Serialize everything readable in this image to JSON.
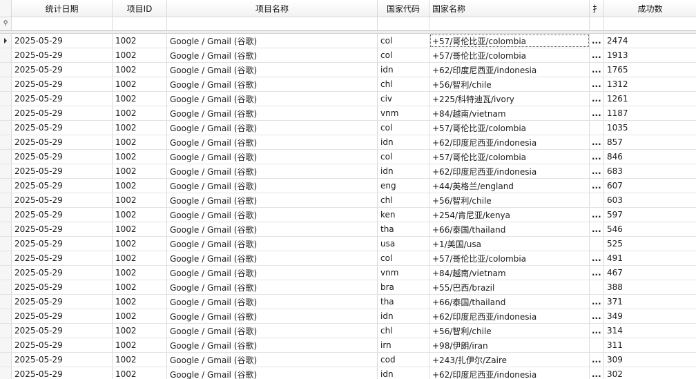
{
  "columns": {
    "date": "统计日期",
    "project_id": "项目ID",
    "project_name": "项目名称",
    "country_code": "国家代码",
    "country_name": "国家名称",
    "truncated": "扌",
    "success_count": "成功数"
  },
  "filter_icon": "filter-icon",
  "ellipsis": "...",
  "rows": [
    {
      "date": "2025-05-29",
      "pid": "1002",
      "name": "Google / Gmail (谷歌)",
      "code": "col",
      "country": "+57/哥伦比亚/colombia",
      "trunc": true,
      "count": "2474"
    },
    {
      "date": "2025-05-29",
      "pid": "1002",
      "name": "Google / Gmail (谷歌)",
      "code": "col",
      "country": "+57/哥伦比亚/colombia",
      "trunc": true,
      "count": "1913"
    },
    {
      "date": "2025-05-29",
      "pid": "1002",
      "name": "Google / Gmail (谷歌)",
      "code": "idn",
      "country": "+62/印度尼西亚/indonesia",
      "trunc": true,
      "count": "1765"
    },
    {
      "date": "2025-05-29",
      "pid": "1002",
      "name": "Google / Gmail (谷歌)",
      "code": "chl",
      "country": "+56/智利/chile",
      "trunc": true,
      "count": "1312"
    },
    {
      "date": "2025-05-29",
      "pid": "1002",
      "name": "Google / Gmail (谷歌)",
      "code": "civ",
      "country": "+225/科特迪瓦/ivory",
      "trunc": true,
      "count": "1261"
    },
    {
      "date": "2025-05-29",
      "pid": "1002",
      "name": "Google / Gmail (谷歌)",
      "code": "vnm",
      "country": "+84/越南/vietnam",
      "trunc": true,
      "count": "1187"
    },
    {
      "date": "2025-05-29",
      "pid": "1002",
      "name": "Google / Gmail (谷歌)",
      "code": "col",
      "country": "+57/哥伦比亚/colombia",
      "trunc": false,
      "count": "1035"
    },
    {
      "date": "2025-05-29",
      "pid": "1002",
      "name": "Google / Gmail (谷歌)",
      "code": "idn",
      "country": "+62/印度尼西亚/indonesia",
      "trunc": true,
      "count": "857"
    },
    {
      "date": "2025-05-29",
      "pid": "1002",
      "name": "Google / Gmail (谷歌)",
      "code": "col",
      "country": "+57/哥伦比亚/colombia",
      "trunc": true,
      "count": "846"
    },
    {
      "date": "2025-05-29",
      "pid": "1002",
      "name": "Google / Gmail (谷歌)",
      "code": "idn",
      "country": "+62/印度尼西亚/indonesia",
      "trunc": true,
      "count": "683"
    },
    {
      "date": "2025-05-29",
      "pid": "1002",
      "name": "Google / Gmail (谷歌)",
      "code": "eng",
      "country": "+44/英格兰/england",
      "trunc": true,
      "count": "607"
    },
    {
      "date": "2025-05-29",
      "pid": "1002",
      "name": "Google / Gmail (谷歌)",
      "code": "chl",
      "country": "+56/智利/chile",
      "trunc": false,
      "count": "603"
    },
    {
      "date": "2025-05-29",
      "pid": "1002",
      "name": "Google / Gmail (谷歌)",
      "code": "ken",
      "country": "+254/肯尼亚/kenya",
      "trunc": true,
      "count": "597"
    },
    {
      "date": "2025-05-29",
      "pid": "1002",
      "name": "Google / Gmail (谷歌)",
      "code": "tha",
      "country": "+66/泰国/thailand",
      "trunc": true,
      "count": "546"
    },
    {
      "date": "2025-05-29",
      "pid": "1002",
      "name": "Google / Gmail (谷歌)",
      "code": "usa",
      "country": "+1/美国/usa",
      "trunc": false,
      "count": "525"
    },
    {
      "date": "2025-05-29",
      "pid": "1002",
      "name": "Google / Gmail (谷歌)",
      "code": "col",
      "country": "+57/哥伦比亚/colombia",
      "trunc": true,
      "count": "491"
    },
    {
      "date": "2025-05-29",
      "pid": "1002",
      "name": "Google / Gmail (谷歌)",
      "code": "vnm",
      "country": "+84/越南/vietnam",
      "trunc": true,
      "count": "467"
    },
    {
      "date": "2025-05-29",
      "pid": "1002",
      "name": "Google / Gmail (谷歌)",
      "code": "bra",
      "country": "+55/巴西/brazil",
      "trunc": false,
      "count": "388"
    },
    {
      "date": "2025-05-29",
      "pid": "1002",
      "name": "Google / Gmail (谷歌)",
      "code": "tha",
      "country": "+66/泰国/thailand",
      "trunc": true,
      "count": "371"
    },
    {
      "date": "2025-05-29",
      "pid": "1002",
      "name": "Google / Gmail (谷歌)",
      "code": "idn",
      "country": "+62/印度尼西亚/indonesia",
      "trunc": true,
      "count": "349"
    },
    {
      "date": "2025-05-29",
      "pid": "1002",
      "name": "Google / Gmail (谷歌)",
      "code": "chl",
      "country": "+56/智利/chile",
      "trunc": true,
      "count": "314"
    },
    {
      "date": "2025-05-29",
      "pid": "1002",
      "name": "Google / Gmail (谷歌)",
      "code": "irn",
      "country": "+98/伊朗/iran",
      "trunc": false,
      "count": "311"
    },
    {
      "date": "2025-05-29",
      "pid": "1002",
      "name": "Google / Gmail (谷歌)",
      "code": "cod",
      "country": "+243/扎伊尔/Zaire",
      "trunc": true,
      "count": "309"
    },
    {
      "date": "2025-05-29",
      "pid": "1002",
      "name": "Google / Gmail (谷歌)",
      "code": "idn",
      "country": "+62/印度尼西亚/indonesia",
      "trunc": true,
      "count": "302"
    }
  ]
}
